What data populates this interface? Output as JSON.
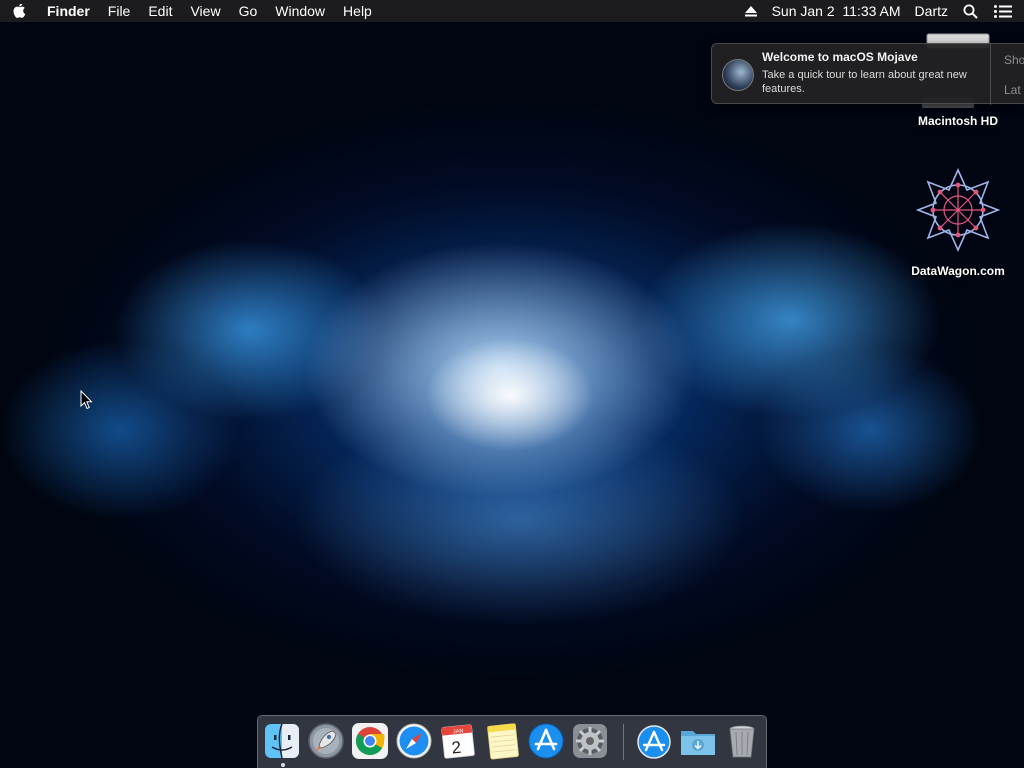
{
  "menubar": {
    "app_name": "Finder",
    "menus": [
      "File",
      "Edit",
      "View",
      "Go",
      "Window",
      "Help"
    ],
    "datetime": "Sun Jan 2  11:33 AM",
    "user": "Dartz",
    "icons": [
      "apple-icon",
      "eject-icon",
      "spotlight-icon",
      "notification-center-icon"
    ]
  },
  "notification": {
    "title": "Welcome to macOS Mojave",
    "body": "Take a quick tour to learn about great new features.",
    "primary_button": "Sho",
    "secondary_button": "Lat",
    "icon": "mojave-icon"
  },
  "desktop": {
    "icons": [
      {
        "label": "Macintosh HD",
        "icon": "hard-drive-icon"
      },
      {
        "label": "DataWagon.com",
        "icon": "datawagon-logo-icon"
      }
    ]
  },
  "dock": {
    "apps": [
      {
        "name": "finder",
        "icon": "finder-icon",
        "running": true
      },
      {
        "name": "launchpad",
        "icon": "rocket-icon",
        "running": false
      },
      {
        "name": "chrome",
        "icon": "chrome-icon",
        "running": false
      },
      {
        "name": "safari",
        "icon": "safari-icon",
        "running": false
      },
      {
        "name": "calendar",
        "icon": "calendar-icon",
        "running": false
      },
      {
        "name": "notes",
        "icon": "notes-icon",
        "running": false
      },
      {
        "name": "app-store",
        "icon": "app-store-icon",
        "running": false
      },
      {
        "name": "system-preferences",
        "icon": "gear-icon",
        "running": false
      },
      {
        "name": "applications",
        "icon": "app-store-icon",
        "running": false
      },
      {
        "name": "downloads",
        "icon": "downloads-folder-icon",
        "running": false
      },
      {
        "name": "trash",
        "icon": "trash-icon",
        "running": false
      }
    ],
    "calendar": {
      "month": "JAN",
      "day": "2"
    }
  },
  "colors": {
    "menubar_bg": "#1e1e20",
    "notification_bg": "#222224",
    "wallpaper_dark": "#000511",
    "wallpaper_blue": "#0a50aa"
  }
}
